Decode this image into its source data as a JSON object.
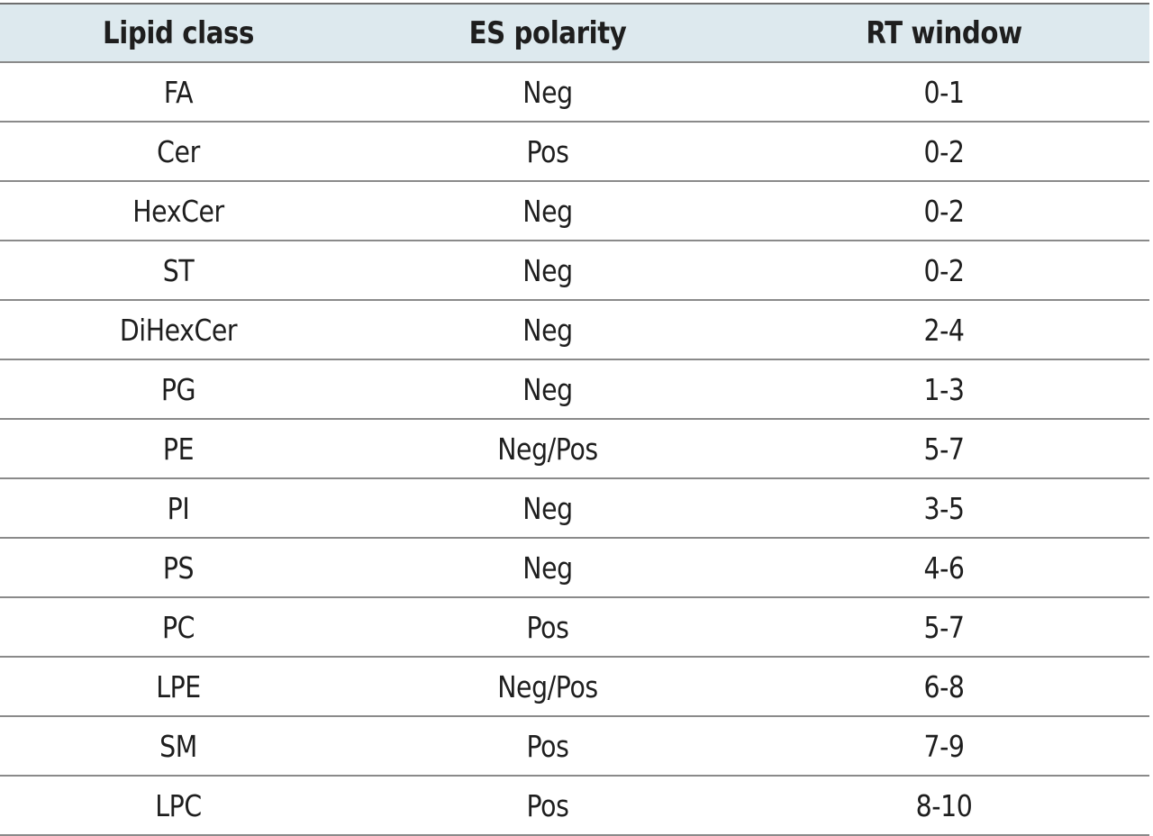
{
  "table": {
    "headers": [
      "Lipid class",
      "ES polarity",
      "RT window"
    ],
    "rows": [
      [
        "FA",
        "Neg",
        "0-1"
      ],
      [
        "Cer",
        "Pos",
        "0-2"
      ],
      [
        "HexCer",
        "Neg",
        "0-2"
      ],
      [
        "ST",
        "Neg",
        "0-2"
      ],
      [
        "DiHexCer",
        "Neg",
        "2-4"
      ],
      [
        "PG",
        "Neg",
        "1-3"
      ],
      [
        "PE",
        "Neg/Pos",
        "5-7"
      ],
      [
        "PI",
        "Neg",
        "3-5"
      ],
      [
        "PS",
        "Neg",
        "4-6"
      ],
      [
        "PC",
        "Pos",
        "5-7"
      ],
      [
        "LPE",
        "Neg/Pos",
        "6-8"
      ],
      [
        "SM",
        "Pos",
        "7-9"
      ],
      [
        "LPC",
        "Pos",
        "8-10"
      ]
    ]
  },
  "colors": {
    "header_bg": "#dde9ee",
    "rule": "#8a8a8a",
    "text": "#1e1e1e"
  }
}
